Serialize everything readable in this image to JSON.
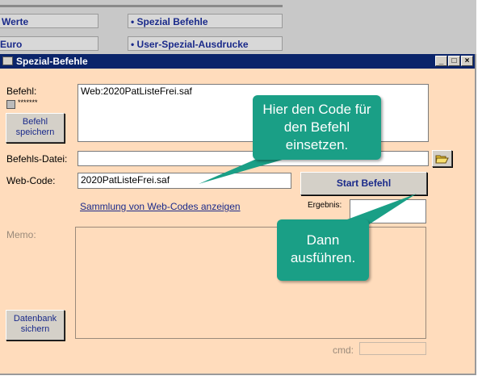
{
  "background_app": {
    "btn_werte": "Werte",
    "btn_spezial_befehle": "• Spezial Befehle",
    "btn_euro": "Euro",
    "btn_user_spezial": "• User-Spezial-Ausdrucke"
  },
  "window": {
    "title": "Spezial-Befehle",
    "min": "_",
    "max": "□",
    "close": "×"
  },
  "form": {
    "befehl_label": "Befehl:",
    "befehl_value": "Web:2020PatListeFrei.saf",
    "dots": "*******",
    "save_button": "Befehl speichern",
    "befehlsdatei_label": "Befehls-Datei:",
    "befehlsdatei_value": "",
    "webcode_label": "Web-Code:",
    "webcode_value": "2020PatListeFrei.saf",
    "start_button": "Start Befehl",
    "sammlung_link": "Sammlung von Web-Codes anzeigen",
    "ergebnis_label": "Ergebnis:",
    "ergebnis_value": "",
    "memo_label": "Memo:",
    "datenbank_button": "Datenbank sichern",
    "cmd_label": "cmd:"
  },
  "callouts": {
    "code": "Hier den Code für den Befehl einsetzen.",
    "run": "Dann ausführen."
  },
  "colors": {
    "window_bg": "#ffdcbc",
    "titlebar": "#0a246a",
    "callout": "#1a9f86"
  }
}
